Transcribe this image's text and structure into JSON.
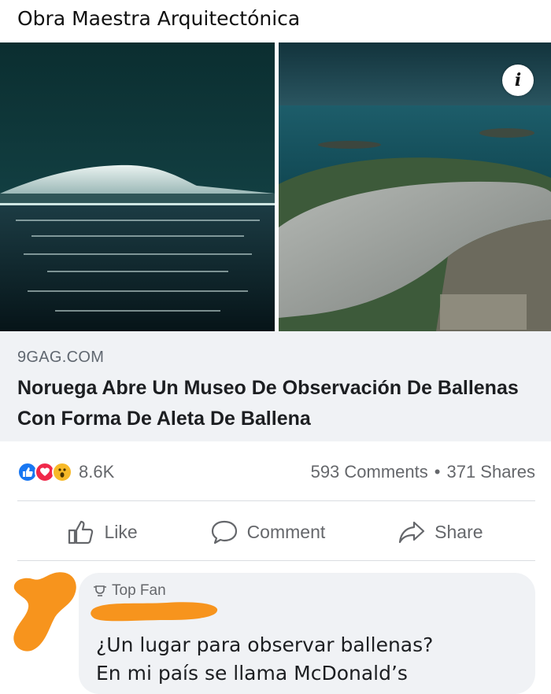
{
  "caption": "Obra Maestra Arquitectónica",
  "post": {
    "info_badge": "i",
    "link": {
      "domain": "9GAG.COM",
      "title": "Noruega Abre Un Museo De  Observación De Ballenas Con Forma De Aleta De Ballena"
    },
    "stats": {
      "reactions": [
        "like-reaction-icon",
        "love-reaction-icon",
        "wow-reaction-icon"
      ],
      "reaction_count": "8.6K",
      "comments": "593 Comments",
      "separator": "•",
      "shares": "371 Shares"
    },
    "actions": {
      "like": "Like",
      "comment": "Comment",
      "share": "Share"
    }
  },
  "comment": {
    "badge": "Top Fan",
    "lines": [
      "¿Un lugar para observar ballenas?",
      "En mi país se llama McDonald’s"
    ]
  },
  "colors": {
    "scribble": "#f7941d",
    "link_box_bg": "#f0f2f5",
    "like_blue": "#1877f2"
  }
}
